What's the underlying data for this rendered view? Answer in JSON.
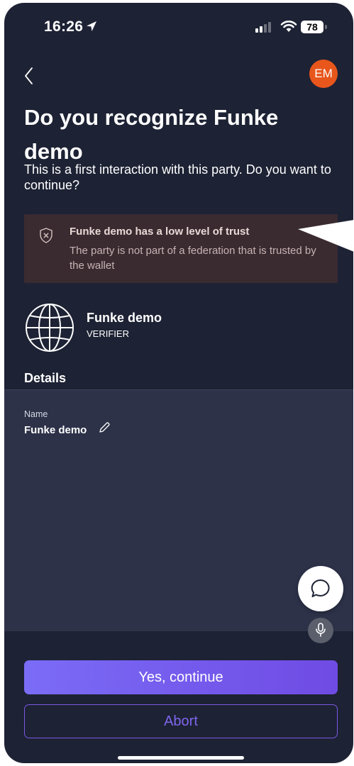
{
  "status_bar": {
    "time": "16:26",
    "battery": "78",
    "icons": [
      "location-arrow-icon",
      "cellular-signal-icon",
      "wifi-icon",
      "battery-icon"
    ]
  },
  "header": {
    "back_icon": "chevron-left-icon",
    "avatar_initials": "EM",
    "avatar_color": "#e8561c"
  },
  "page": {
    "title": "Do you recognize Funke demo",
    "subtitle": "This is a first interaction with this party. Do you want to continue?"
  },
  "warning": {
    "icon": "shield-x-icon",
    "title": "Funke demo has a low level of trust",
    "text": "The party is not part of a federation that is trusted by the wallet",
    "background_color": "#3a2b31"
  },
  "party": {
    "logo_icon": "globe-icon",
    "name": "Funke demo",
    "role": "VERIFIER"
  },
  "details": {
    "heading": "Details",
    "fields": [
      {
        "label": "Name",
        "value": "Funke demo",
        "icon": "pencil-icon"
      }
    ]
  },
  "floating": {
    "chat_icon": "chat-bubble-icon",
    "mic_icon": "microphone-icon"
  },
  "actions": {
    "primary_label": "Yes, continue",
    "secondary_label": "Abort",
    "accent_color": "#7b6cf6"
  },
  "theme": {
    "background": "#1d2234",
    "panel": "#2d3249"
  }
}
